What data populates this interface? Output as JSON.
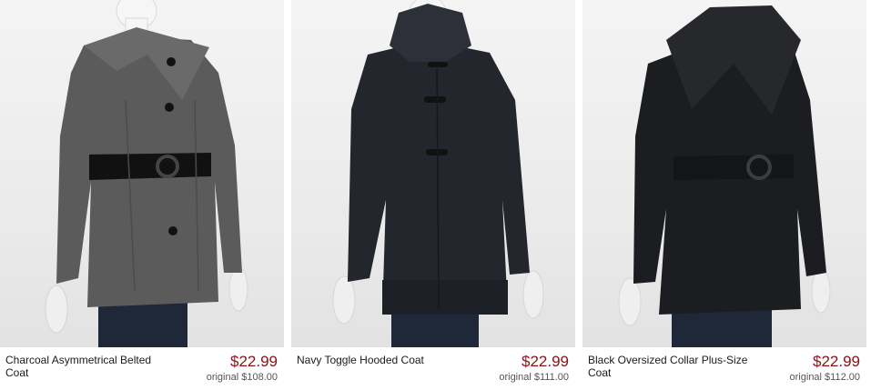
{
  "products": [
    {
      "name": "Charcoal Asymmetrical Belted Coat",
      "price": "$22.99",
      "original": "original $108.00",
      "coat_color": "#5b5b5b"
    },
    {
      "name": "Navy Toggle Hooded Coat",
      "price": "$22.99",
      "original": "original $111.00",
      "coat_color": "#23262d"
    },
    {
      "name": "Black Oversized Collar Plus-Size Coat",
      "price": "$22.99",
      "original": "original $112.00",
      "coat_color": "#1c1d20"
    }
  ],
  "colors": {
    "price": "#8b1014",
    "jeans": "#1f2838",
    "mannequin": "#f2f2f2"
  }
}
